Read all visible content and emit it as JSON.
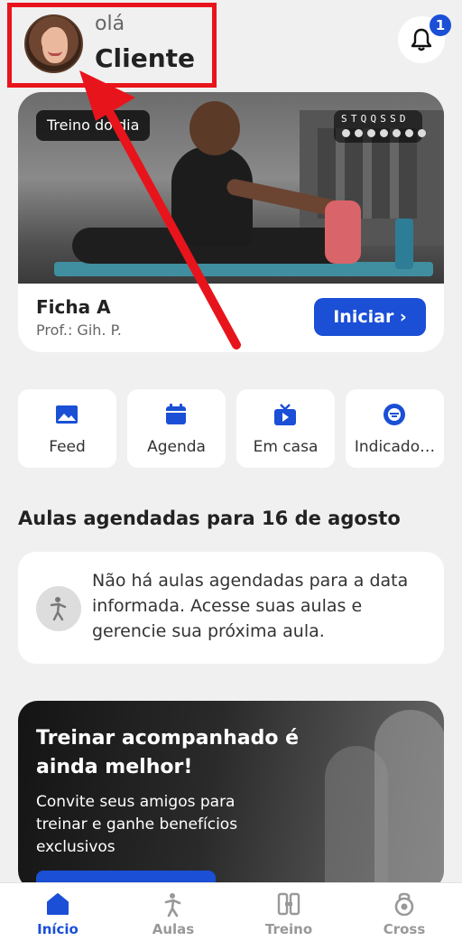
{
  "header": {
    "greeting": "olá",
    "user_name": "Cliente",
    "notification_count": "1"
  },
  "workout": {
    "tag": "Treino do dia",
    "week_days": "STQQSSD",
    "title": "Ficha A",
    "professor": "Prof.: Gih. P.",
    "start_label": "Iniciar ›"
  },
  "quick_actions": [
    {
      "label": "Feed",
      "icon": "image-icon"
    },
    {
      "label": "Agenda",
      "icon": "calendar-icon"
    },
    {
      "label": "Em casa",
      "icon": "tv-play-icon"
    },
    {
      "label": "Indicado…",
      "icon": "indicators-icon"
    }
  ],
  "schedule": {
    "title": "Aulas agendadas para 16 de agosto",
    "empty_text": "Não há aulas agendadas para a data informada. Acesse suas aulas e gerencie sua próxima aula."
  },
  "promo": {
    "title": "Treinar acompanhado é ainda melhor!",
    "text": "Convite seus amigos para treinar e ganhe benefícios exclusivos"
  },
  "tabs": [
    {
      "label": "Início",
      "active": true
    },
    {
      "label": "Aulas",
      "active": false
    },
    {
      "label": "Treino",
      "active": false
    },
    {
      "label": "Cross",
      "active": false
    }
  ],
  "colors": {
    "accent": "#1a4fd6",
    "annotation": "#e8141c",
    "background": "#f0f0f0"
  }
}
